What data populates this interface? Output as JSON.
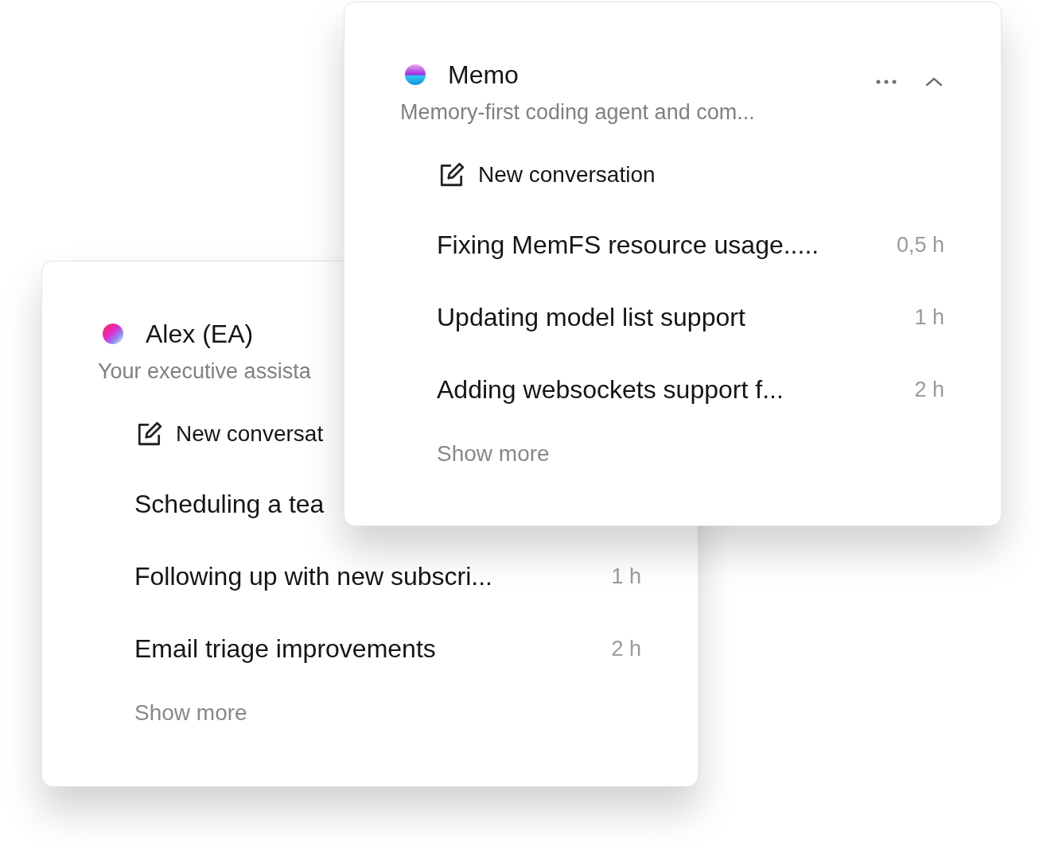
{
  "cards": [
    {
      "kind": "alex",
      "title": "Alex (EA)",
      "subtitle": "Your executive assista",
      "new_conversation": "New conversat",
      "conversations": [
        {
          "title": "Scheduling a tea"
        },
        {
          "title": "Following up with new subscri...",
          "time": "1 h"
        },
        {
          "title": "Email triage improvements",
          "time": "2 h"
        }
      ],
      "show_more": "Show more"
    },
    {
      "kind": "memo",
      "title": "Memo",
      "subtitle": "Memory-first coding agent and com...",
      "expanded": true,
      "new_conversation": "New conversation",
      "conversations": [
        {
          "title": "Fixing MemFS resource usage.....",
          "time": "0,5 h"
        },
        {
          "title": "Updating model list support",
          "time": "1 h"
        },
        {
          "title": "Adding websockets support f...",
          "time": "2 h"
        }
      ],
      "show_more": "Show more"
    }
  ]
}
